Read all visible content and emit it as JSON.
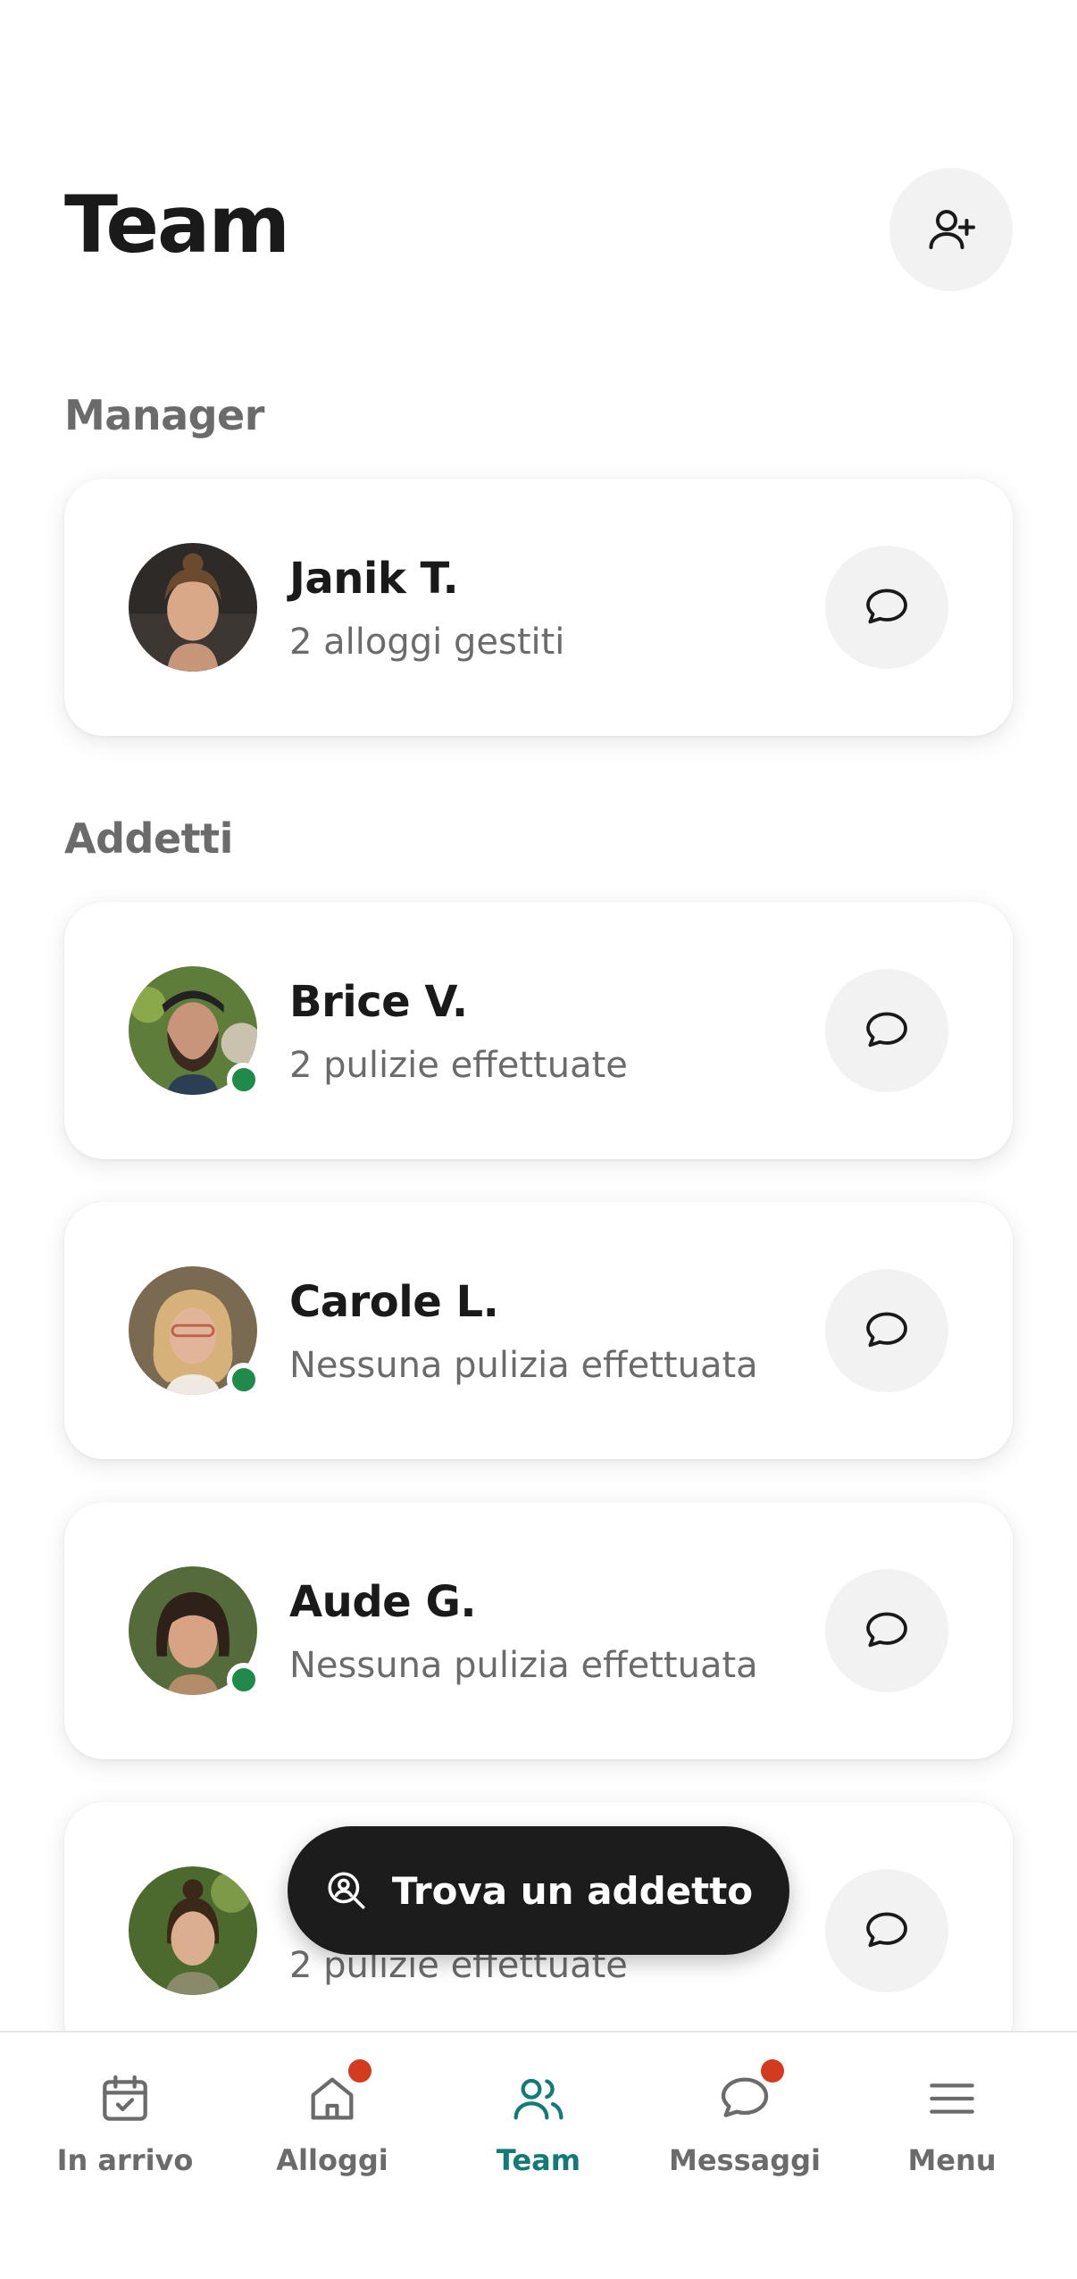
{
  "header": {
    "title": "Team"
  },
  "sections": {
    "managers_label": "Manager",
    "staff_label": "Addetti"
  },
  "managers": [
    {
      "name": "Janik T.",
      "subtitle": "2 alloggi gestiti",
      "online": false
    }
  ],
  "staff": [
    {
      "name": "Brice V.",
      "subtitle": "2 pulizie effettuate",
      "online": true
    },
    {
      "name": "Carole L.",
      "subtitle": "Nessuna pulizia effettuata",
      "online": true
    },
    {
      "name": "Aude G.",
      "subtitle": "Nessuna pulizia effettuata",
      "online": true
    },
    {
      "name": "",
      "subtitle": "2 pulizie effettuate",
      "online": false
    }
  ],
  "fab": {
    "label": "Trova un addetto",
    "icon": "search-person-icon"
  },
  "bottom_nav": {
    "items": [
      {
        "label": "In arrivo",
        "icon": "calendar-check-icon",
        "badge": false,
        "active": false
      },
      {
        "label": "Alloggi",
        "icon": "home-icon",
        "badge": true,
        "active": false
      },
      {
        "label": "Team",
        "icon": "users-icon",
        "badge": false,
        "active": true
      },
      {
        "label": "Messaggi",
        "icon": "chat-bubble-icon",
        "badge": true,
        "active": false
      },
      {
        "label": "Menu",
        "icon": "menu-icon",
        "badge": false,
        "active": false
      }
    ]
  },
  "colors": {
    "accent": "#137a7a",
    "online": "#1f8a4a",
    "badge": "#d23b1e",
    "fab_bg": "#1c1c1c",
    "button_bg": "#f2f2f2"
  }
}
